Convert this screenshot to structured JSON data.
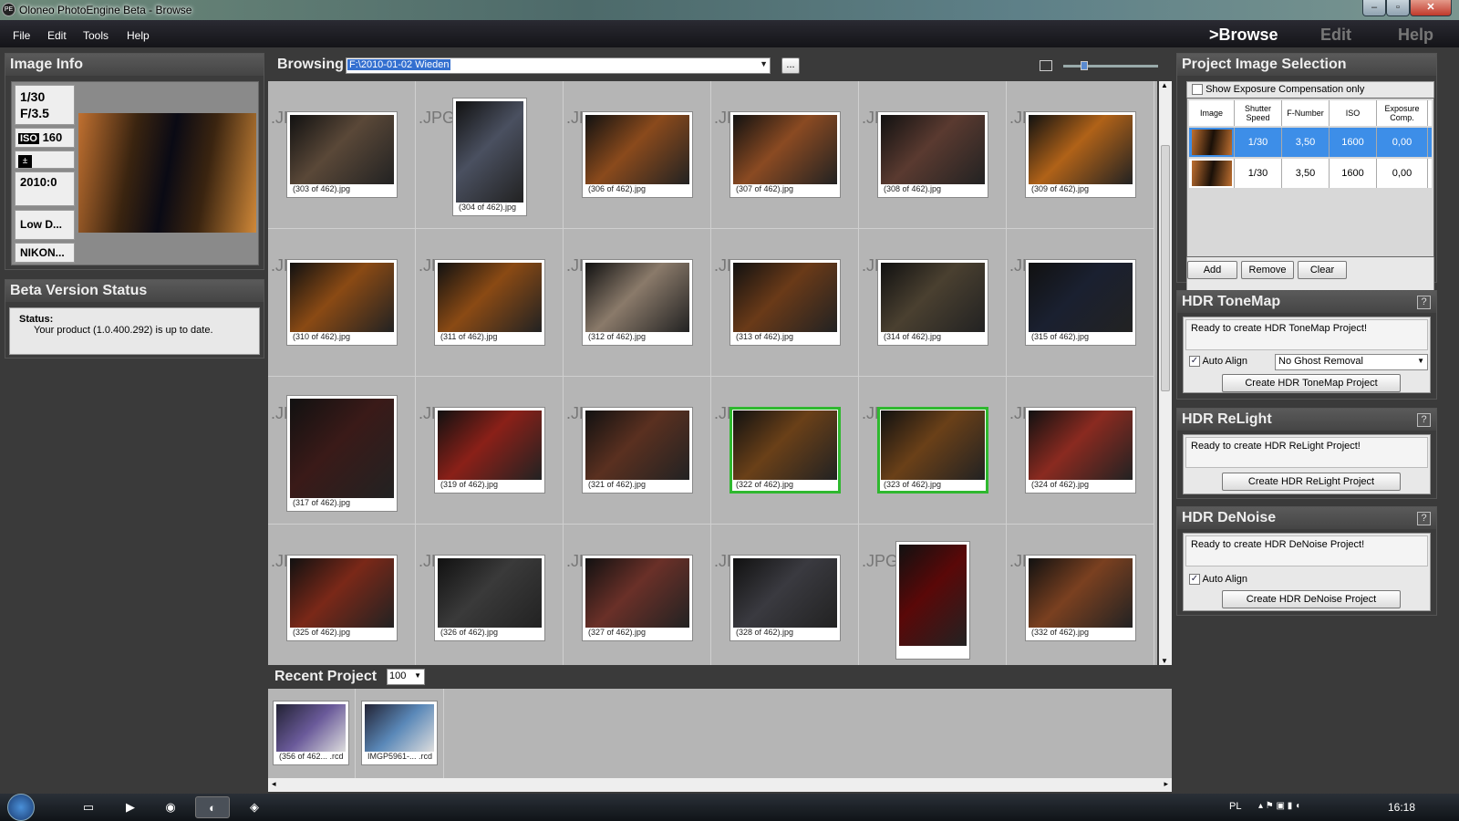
{
  "window": {
    "title": "Oloneo PhotoEngine Beta - Browse",
    "app_icon": "PE"
  },
  "menu": [
    "File",
    "Edit",
    "Tools",
    "Help"
  ],
  "modes": {
    "browse": ">Browse",
    "edit": "Edit",
    "help": "Help"
  },
  "image_info": {
    "title": "Image Info",
    "shutter": "1/30",
    "fnumber": "F/3.5",
    "iso_badge": "ISO",
    "iso": "160",
    "date": "2010:0",
    "lens": "Low D...",
    "camera": "NIKON..."
  },
  "beta": {
    "title": "Beta Version Status",
    "status_label": "Status:",
    "status_text": "Your product (1.0.400.292) is up to date."
  },
  "browse": {
    "label": "Browsing",
    "path": "F:\\2010-01-02 Wieden",
    "browse_button": "...",
    "zoom_pct": 0.2
  },
  "grid": {
    "ext": ".JPG",
    "thumbs": [
      {
        "cap": "(303 of 462).jpg",
        "shape": "land",
        "tone": "#5a4838"
      },
      {
        "cap": "(304 of 462).jpg",
        "shape": "port",
        "tone": "#4a5060"
      },
      {
        "cap": "(306 of 462).jpg",
        "shape": "land",
        "tone": "#8a4a1c"
      },
      {
        "cap": "(307 of 462).jpg",
        "shape": "land",
        "tone": "#8a4a22"
      },
      {
        "cap": "(308 of 462).jpg",
        "shape": "land",
        "tone": "#5a3a30"
      },
      {
        "cap": "(309 of 462).jpg",
        "shape": "land",
        "tone": "#b06218"
      },
      {
        "cap": "(310 of 462).jpg",
        "shape": "land",
        "tone": "#8a4a14"
      },
      {
        "cap": "(311 of 462).jpg",
        "shape": "land",
        "tone": "#8a4a14"
      },
      {
        "cap": "(312 of 462).jpg",
        "shape": "land",
        "tone": "#8a7a6a"
      },
      {
        "cap": "(313 of 462).jpg",
        "shape": "land",
        "tone": "#6a3a18"
      },
      {
        "cap": "(314 of 462).jpg",
        "shape": "land",
        "tone": "#4a4030"
      },
      {
        "cap": "(315 of 462).jpg",
        "shape": "land",
        "tone": "#1a2030"
      },
      {
        "cap": "(317 of 462).jpg",
        "shape": "tall",
        "tone": "#3a1a18"
      },
      {
        "cap": "(319 of 462).jpg",
        "shape": "land",
        "tone": "#8a2018"
      },
      {
        "cap": "(321 of 462).jpg",
        "shape": "land",
        "tone": "#5a3020"
      },
      {
        "cap": "(322 of 462).jpg",
        "shape": "land",
        "tone": "#6a4018",
        "sel": true
      },
      {
        "cap": "(323 of 462).jpg",
        "shape": "land",
        "tone": "#6a4018",
        "sel": true
      },
      {
        "cap": "(324 of 462).jpg",
        "shape": "land",
        "tone": "#8a2a20"
      },
      {
        "cap": "(325 of 462).jpg",
        "shape": "land",
        "tone": "#7a2818"
      },
      {
        "cap": "(326 of 462).jpg",
        "shape": "land",
        "tone": "#3a3a3a"
      },
      {
        "cap": "(327 of 462).jpg",
        "shape": "land",
        "tone": "#6a3028"
      },
      {
        "cap": "(328 of 462).jpg",
        "shape": "land",
        "tone": "#3a3a40"
      },
      {
        "cap": "",
        "shape": "port",
        "tone": "#5a0808"
      },
      {
        "cap": "(332 of 462).jpg",
        "shape": "land",
        "tone": "#7a4020"
      }
    ]
  },
  "recent": {
    "title": "Recent Project",
    "count": "100",
    "items": [
      {
        "cap": "(356 of 462... .rcd",
        "tone": "#6a5a9a"
      },
      {
        "cap": "IMGP5961-... .rcd",
        "tone": "#5a88b8"
      }
    ]
  },
  "selection": {
    "title": "Project Image Selection",
    "show_exposure_label": "Show Exposure Compensation only",
    "columns": [
      "Image",
      "Shutter Speed",
      "F-Number",
      "ISO",
      "Exposure Comp."
    ],
    "rows": [
      {
        "shutter": "1/30",
        "fnumber": "3,50",
        "iso": "1600",
        "exp": "0,00",
        "selected": true
      },
      {
        "shutter": "1/30",
        "fnumber": "3,50",
        "iso": "1600",
        "exp": "0,00",
        "selected": false
      }
    ],
    "add": "Add",
    "remove": "Remove",
    "clear": "Clear"
  },
  "tonemap": {
    "title": "HDR ToneMap",
    "help": "?",
    "ready": "Ready to create HDR ToneMap Project!",
    "auto_align": "Auto Align",
    "ghost": "No Ghost Removal",
    "create": "Create HDR ToneMap Project"
  },
  "relight": {
    "title": "HDR ReLight",
    "help": "?",
    "ready": "Ready to create HDR ReLight Project!",
    "create": "Create HDR ReLight Project"
  },
  "denoise": {
    "title": "HDR DeNoise",
    "help": "?",
    "ready": "Ready to create HDR DeNoise Project!",
    "auto_align": "Auto Align",
    "create": "Create HDR DeNoise Project"
  },
  "taskbar": {
    "lang": "PL",
    "time": "16:18",
    "check": "✓",
    "dropdown": "▼"
  }
}
